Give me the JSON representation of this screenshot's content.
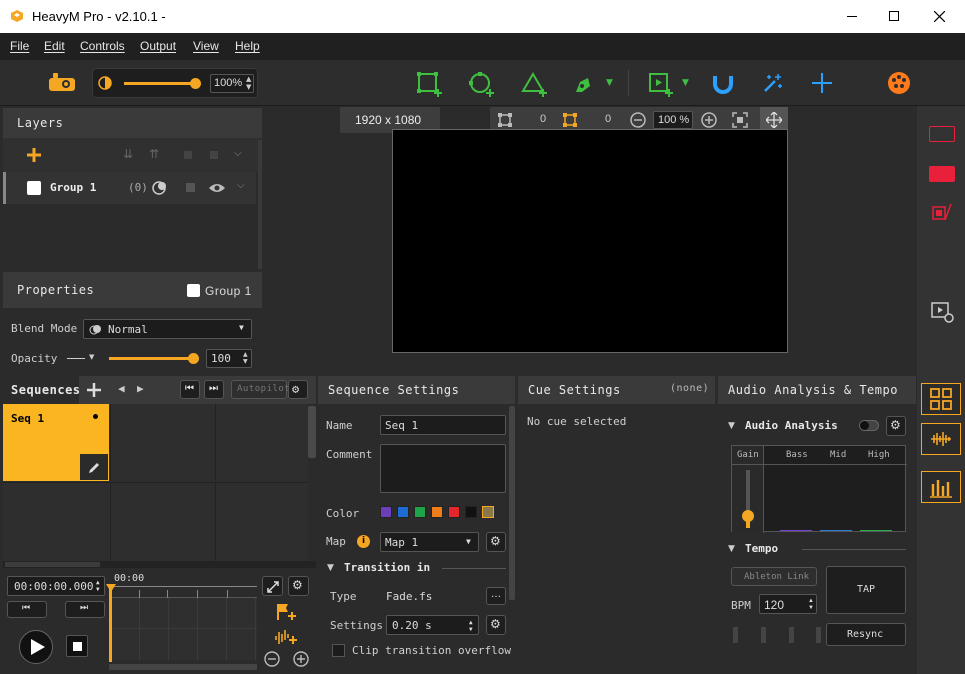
{
  "window": {
    "title": "HeavyM Pro - v2.10.1 -"
  },
  "menu": [
    "File",
    "Edit",
    "Controls",
    "Output",
    "View",
    "Help"
  ],
  "toolbar": {
    "brightness_value": "100%",
    "brightness_level": 1.0
  },
  "canvas": {
    "resolution": "1920 x 1080",
    "shape_count": "0",
    "vertex_count": "0",
    "zoom": "100 %"
  },
  "layers": {
    "title": "Layers",
    "group_name": "Group 1",
    "group_count": "(0)"
  },
  "properties": {
    "title": "Properties",
    "group_label": "Group 1",
    "blend_mode_label": "Blend Mode",
    "blend_mode_value": "Normal",
    "opacity_label": "Opacity",
    "opacity_value": "100",
    "opacity_level": 1.0
  },
  "sequences": {
    "title": "Sequences",
    "autopilot": "Autopilot",
    "seq_name": "Seq 1",
    "timecode": "00:00:00.000",
    "timeline_start": "00:00"
  },
  "sequence_settings": {
    "title": "Sequence Settings",
    "name_label": "Name",
    "name_value": "Seq 1",
    "comment_label": "Comment",
    "color_label": "Color",
    "map_label": "Map",
    "map_value": "Map 1",
    "transition_in": "Transition in",
    "type_label": "Type",
    "type_value": "Fade.fs",
    "settings_label": "Settings",
    "settings_value": "0.20 s",
    "clip_label": "Clip transition overflow",
    "colors": [
      "#6b3fb5",
      "#1e6bd6",
      "#1fa34a",
      "#f07d1a",
      "#e3262c",
      "#111111",
      "#8a7a4a"
    ]
  },
  "cue_settings": {
    "title": "Cue Settings",
    "none": "(none)",
    "empty": "No cue selected"
  },
  "audio": {
    "title": "Audio Analysis & Tempo",
    "analysis": "Audio Analysis",
    "gain": "Gain",
    "bass": "Bass",
    "mid": "Mid",
    "high": "High",
    "tempo": "Tempo",
    "ableton": "Ableton Link",
    "bpm_label": "BPM",
    "bpm_value": "120",
    "tap": "TAP",
    "resync": "Resync",
    "gain_level": 0.2
  },
  "colors": {
    "accent": "#f5a623",
    "panel": "#3a3a3a",
    "bg": "#2b2b2b",
    "toolgreen": "#3fbf3f",
    "toolblue": "#2aa0ff",
    "orange": "#ff7a1a",
    "red": "#e8203a"
  }
}
